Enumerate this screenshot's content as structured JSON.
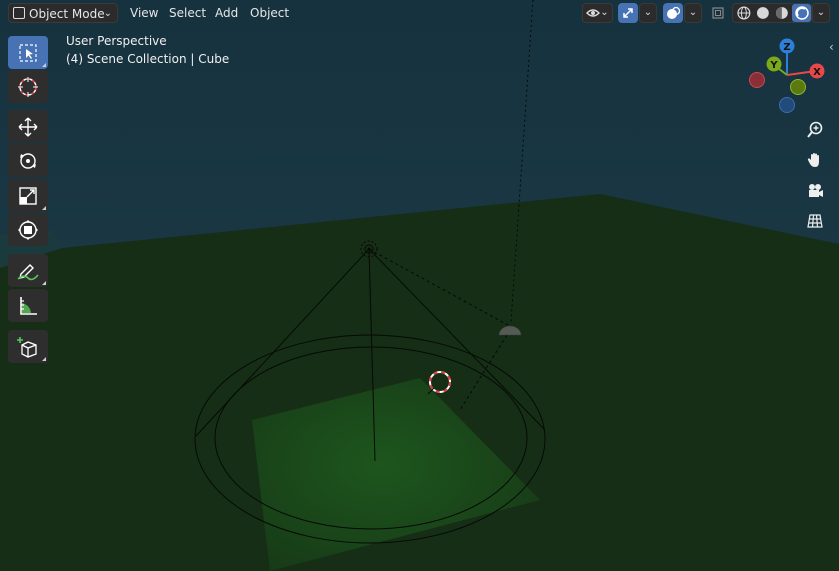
{
  "header": {
    "mode_label": "Object Mode",
    "menus": [
      "View",
      "Select",
      "Add",
      "Object"
    ]
  },
  "overlay": {
    "perspective": "User Perspective",
    "collection": "(4) Scene Collection | Cube"
  },
  "gizmo": {
    "z": "Z",
    "y": "Y",
    "x": "X"
  },
  "icons": {
    "mode": "object-mode-icon",
    "visibility": "eye-icon",
    "gizmo": "gizmo-arrows-icon",
    "overlay": "overlay-circles-icon",
    "xray": "xray-icon",
    "shading": [
      "wireframe-icon",
      "solid-icon",
      "material-icon",
      "rendered-icon"
    ],
    "tools": [
      "select-box-icon",
      "cursor-icon",
      "move-icon",
      "rotate-icon",
      "scale-icon",
      "transform-icon",
      "annotate-icon",
      "measure-icon",
      "add-cube-icon"
    ],
    "nav": [
      "zoom-icon",
      "hand-pan-icon",
      "camera-icon",
      "grid-ortho-icon"
    ]
  },
  "colors": {
    "active": "#4772b3",
    "background_sky": "#1d3a47",
    "ground": "#163316",
    "x_axis": "#e8484a",
    "y_axis": "#7ba91a",
    "z_axis": "#2e7fd8"
  }
}
